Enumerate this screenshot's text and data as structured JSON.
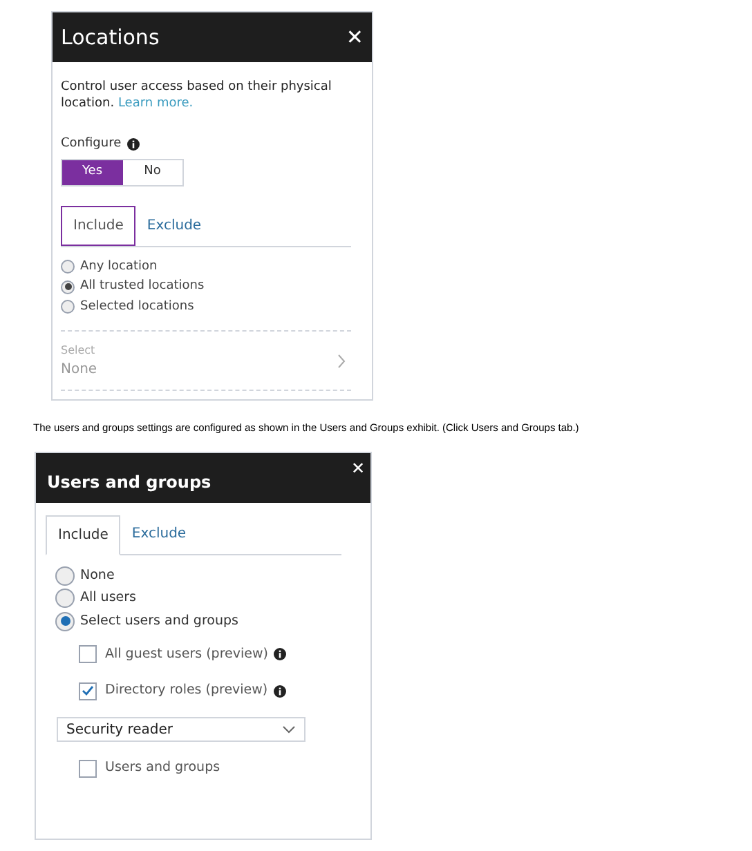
{
  "locations": {
    "title": "Locations",
    "close": "✕",
    "description": "Control user access based on their physical location.",
    "learn_more": "Learn more.",
    "configure_label": "Configure",
    "toggle": [
      {
        "label": "Yes",
        "selected": true
      },
      {
        "label": "No",
        "selected": false
      }
    ],
    "tabs": [
      {
        "label": "Include",
        "selected": true
      },
      {
        "label": "Exclude",
        "selected": false
      }
    ],
    "options": [
      {
        "label": "Any location",
        "selected": false
      },
      {
        "label": "All trusted locations",
        "selected": true
      },
      {
        "label": "Selected locations",
        "selected": false
      }
    ],
    "select": {
      "label": "Select",
      "value": "None"
    }
  },
  "caption": "The users and groups settings are configured as shown in the Users and Groups exhibit. (Click Users and Groups tab.)",
  "users_and_groups": {
    "title": "Users and groups",
    "close": "✕",
    "tabs": [
      {
        "label": "Include",
        "selected": true
      },
      {
        "label": "Exclude",
        "selected": false
      }
    ],
    "options": [
      {
        "label": "None",
        "selected": false
      },
      {
        "label": "All users",
        "selected": false
      },
      {
        "label": "Select users and groups",
        "selected": true
      }
    ],
    "items": [
      {
        "kind": "checkbox",
        "label": "All guest users (preview)",
        "checked": false,
        "info": true
      },
      {
        "kind": "checkbox",
        "label": "Directory roles (preview)",
        "checked": true,
        "info": true
      },
      {
        "kind": "dropdown",
        "value": "Security reader"
      },
      {
        "kind": "checkbox",
        "label": "Users and groups",
        "checked": false,
        "info": false
      }
    ]
  }
}
